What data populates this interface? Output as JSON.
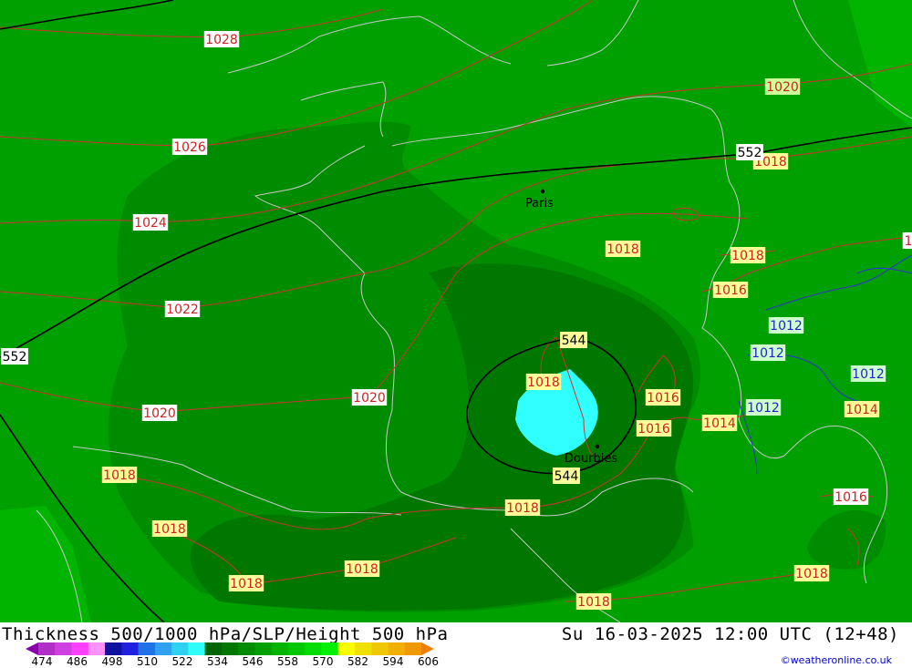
{
  "title": "Thickness 500/1000 hPa/SLP/Height 500 hPa",
  "datetime": "Su 16-03-2025 12:00 UTC (12+48)",
  "credit": "©weatheronline.co.uk",
  "legend": {
    "ticks": [
      "474",
      "486",
      "498",
      "510",
      "522",
      "534",
      "546",
      "558",
      "570",
      "582",
      "594",
      "606"
    ],
    "colors": [
      "#8800aa",
      "#b030c8",
      "#d040e0",
      "#ff40ff",
      "#ff90ff",
      "#1010a0",
      "#2020e0",
      "#2070e8",
      "#30a0f0",
      "#30d0f0",
      "#30ffff",
      "#006400",
      "#007800",
      "#008c00",
      "#00a000",
      "#00b400",
      "#00c800",
      "#00dc00",
      "#00f000",
      "#ffff00",
      "#f0e000",
      "#f0c800",
      "#f0b000",
      "#f09800",
      "#f08000"
    ]
  },
  "cities": [
    {
      "name": "Paris"
    },
    {
      "name": "Dourbies"
    }
  ],
  "slp_labels": [
    {
      "text": "1028"
    },
    {
      "text": "1026"
    },
    {
      "text": "1024"
    },
    {
      "text": "1022"
    },
    {
      "text": "1020"
    },
    {
      "text": "1020"
    },
    {
      "text": "1020"
    },
    {
      "text": "1018"
    },
    {
      "text": "1018"
    },
    {
      "text": "1018"
    },
    {
      "text": "1018"
    },
    {
      "text": "1018"
    },
    {
      "text": "1018"
    },
    {
      "text": "1018"
    },
    {
      "text": "1018"
    },
    {
      "text": "1018"
    },
    {
      "text": "1018"
    },
    {
      "text": "1018"
    },
    {
      "text": "1016"
    },
    {
      "text": "1016"
    },
    {
      "text": "1016"
    },
    {
      "text": "1016"
    },
    {
      "text": "1014"
    },
    {
      "text": "1014"
    },
    {
      "text": "1012"
    },
    {
      "text": "1012"
    },
    {
      "text": "1012"
    },
    {
      "text": "1012"
    },
    {
      "text": "1"
    }
  ],
  "height_labels": [
    {
      "text": "552"
    },
    {
      "text": "552"
    },
    {
      "text": "544"
    },
    {
      "text": "544"
    }
  ],
  "colors": {
    "outer_green": "#00a000",
    "mid_green": "#008c00",
    "dark_green": "#007800",
    "bright_green": "#00b400",
    "cyan": "#30ffff",
    "slp_line": "#cc3333",
    "slp_line_low": "#3333cc",
    "height_line": "#000000",
    "coast": "#c8c8c8"
  }
}
